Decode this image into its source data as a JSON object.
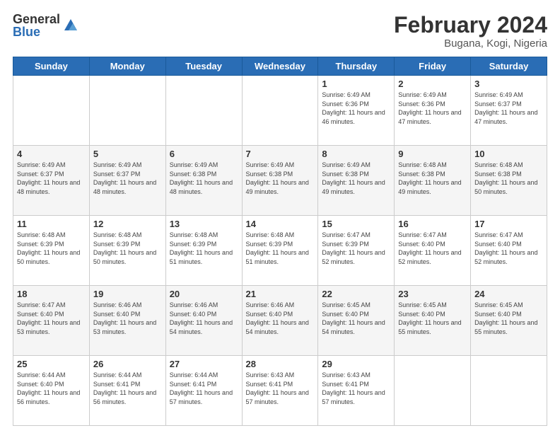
{
  "header": {
    "logo_general": "General",
    "logo_blue": "Blue",
    "title": "February 2024",
    "subtitle": "Bugana, Kogi, Nigeria"
  },
  "days_of_week": [
    "Sunday",
    "Monday",
    "Tuesday",
    "Wednesday",
    "Thursday",
    "Friday",
    "Saturday"
  ],
  "weeks": [
    [
      {
        "day": "",
        "info": ""
      },
      {
        "day": "",
        "info": ""
      },
      {
        "day": "",
        "info": ""
      },
      {
        "day": "",
        "info": ""
      },
      {
        "day": "1",
        "info": "Sunrise: 6:49 AM\nSunset: 6:36 PM\nDaylight: 11 hours and 46 minutes."
      },
      {
        "day": "2",
        "info": "Sunrise: 6:49 AM\nSunset: 6:36 PM\nDaylight: 11 hours and 47 minutes."
      },
      {
        "day": "3",
        "info": "Sunrise: 6:49 AM\nSunset: 6:37 PM\nDaylight: 11 hours and 47 minutes."
      }
    ],
    [
      {
        "day": "4",
        "info": "Sunrise: 6:49 AM\nSunset: 6:37 PM\nDaylight: 11 hours and 48 minutes."
      },
      {
        "day": "5",
        "info": "Sunrise: 6:49 AM\nSunset: 6:37 PM\nDaylight: 11 hours and 48 minutes."
      },
      {
        "day": "6",
        "info": "Sunrise: 6:49 AM\nSunset: 6:38 PM\nDaylight: 11 hours and 48 minutes."
      },
      {
        "day": "7",
        "info": "Sunrise: 6:49 AM\nSunset: 6:38 PM\nDaylight: 11 hours and 49 minutes."
      },
      {
        "day": "8",
        "info": "Sunrise: 6:49 AM\nSunset: 6:38 PM\nDaylight: 11 hours and 49 minutes."
      },
      {
        "day": "9",
        "info": "Sunrise: 6:48 AM\nSunset: 6:38 PM\nDaylight: 11 hours and 49 minutes."
      },
      {
        "day": "10",
        "info": "Sunrise: 6:48 AM\nSunset: 6:38 PM\nDaylight: 11 hours and 50 minutes."
      }
    ],
    [
      {
        "day": "11",
        "info": "Sunrise: 6:48 AM\nSunset: 6:39 PM\nDaylight: 11 hours and 50 minutes."
      },
      {
        "day": "12",
        "info": "Sunrise: 6:48 AM\nSunset: 6:39 PM\nDaylight: 11 hours and 50 minutes."
      },
      {
        "day": "13",
        "info": "Sunrise: 6:48 AM\nSunset: 6:39 PM\nDaylight: 11 hours and 51 minutes."
      },
      {
        "day": "14",
        "info": "Sunrise: 6:48 AM\nSunset: 6:39 PM\nDaylight: 11 hours and 51 minutes."
      },
      {
        "day": "15",
        "info": "Sunrise: 6:47 AM\nSunset: 6:39 PM\nDaylight: 11 hours and 52 minutes."
      },
      {
        "day": "16",
        "info": "Sunrise: 6:47 AM\nSunset: 6:40 PM\nDaylight: 11 hours and 52 minutes."
      },
      {
        "day": "17",
        "info": "Sunrise: 6:47 AM\nSunset: 6:40 PM\nDaylight: 11 hours and 52 minutes."
      }
    ],
    [
      {
        "day": "18",
        "info": "Sunrise: 6:47 AM\nSunset: 6:40 PM\nDaylight: 11 hours and 53 minutes."
      },
      {
        "day": "19",
        "info": "Sunrise: 6:46 AM\nSunset: 6:40 PM\nDaylight: 11 hours and 53 minutes."
      },
      {
        "day": "20",
        "info": "Sunrise: 6:46 AM\nSunset: 6:40 PM\nDaylight: 11 hours and 54 minutes."
      },
      {
        "day": "21",
        "info": "Sunrise: 6:46 AM\nSunset: 6:40 PM\nDaylight: 11 hours and 54 minutes."
      },
      {
        "day": "22",
        "info": "Sunrise: 6:45 AM\nSunset: 6:40 PM\nDaylight: 11 hours and 54 minutes."
      },
      {
        "day": "23",
        "info": "Sunrise: 6:45 AM\nSunset: 6:40 PM\nDaylight: 11 hours and 55 minutes."
      },
      {
        "day": "24",
        "info": "Sunrise: 6:45 AM\nSunset: 6:40 PM\nDaylight: 11 hours and 55 minutes."
      }
    ],
    [
      {
        "day": "25",
        "info": "Sunrise: 6:44 AM\nSunset: 6:40 PM\nDaylight: 11 hours and 56 minutes."
      },
      {
        "day": "26",
        "info": "Sunrise: 6:44 AM\nSunset: 6:41 PM\nDaylight: 11 hours and 56 minutes."
      },
      {
        "day": "27",
        "info": "Sunrise: 6:44 AM\nSunset: 6:41 PM\nDaylight: 11 hours and 57 minutes."
      },
      {
        "day": "28",
        "info": "Sunrise: 6:43 AM\nSunset: 6:41 PM\nDaylight: 11 hours and 57 minutes."
      },
      {
        "day": "29",
        "info": "Sunrise: 6:43 AM\nSunset: 6:41 PM\nDaylight: 11 hours and 57 minutes."
      },
      {
        "day": "",
        "info": ""
      },
      {
        "day": "",
        "info": ""
      }
    ]
  ]
}
